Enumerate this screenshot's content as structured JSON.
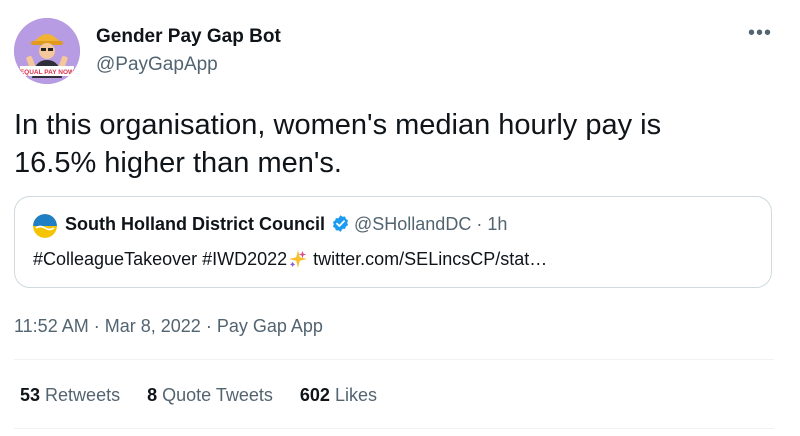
{
  "author": {
    "display_name": "Gender Pay Gap Bot",
    "handle": "@PayGapApp",
    "avatar_banner_text": "EQUAL PAY NOW"
  },
  "more_label": "•••",
  "tweet": {
    "text_line1": "In this organisation, women's median hourly pay is",
    "text_line2": "16.5% higher than men's."
  },
  "quote": {
    "display_name": "South Holland District Council",
    "handle": "@SHollandDC",
    "separator": "·",
    "time": "1h",
    "body_hashtags": "#ColleagueTakeover #IWD2022",
    "body_link": "twitter.com/SELincsCP/stat…"
  },
  "meta": {
    "time": "11:52 AM",
    "separator": "·",
    "date": "Mar 8, 2022",
    "source": "Pay Gap App"
  },
  "stats": {
    "retweets_count": "53",
    "retweets_label": "Retweets",
    "quotes_count": "8",
    "quotes_label": "Quote Tweets",
    "likes_count": "602",
    "likes_label": "Likes"
  },
  "colors": {
    "avatar_bg": "#b79be3",
    "verified": "#1d9bf0",
    "divider": "#eff3f4",
    "secondary_text": "#536471"
  }
}
